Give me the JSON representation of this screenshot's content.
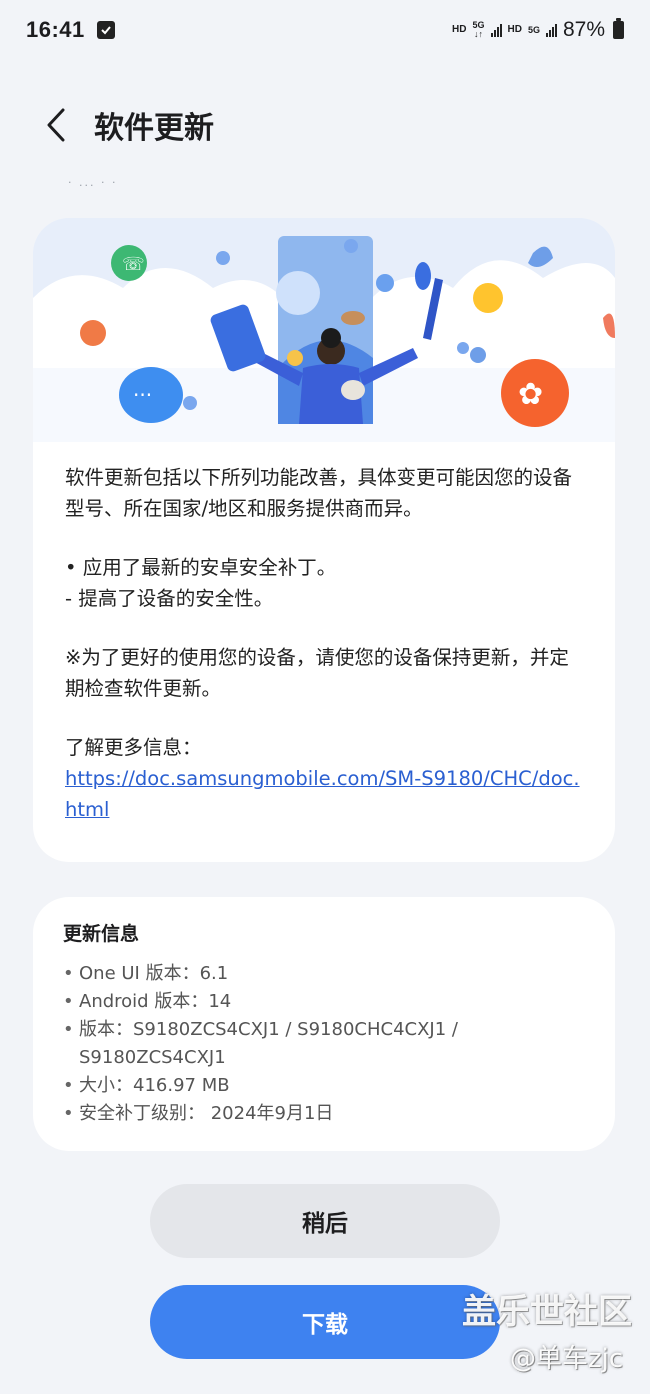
{
  "status_bar": {
    "time": "16:41",
    "hd1": "HD",
    "net1": "5G",
    "hd2": "HD",
    "net2": "5G",
    "battery_percent": "87%"
  },
  "header": {
    "title": "软件更新"
  },
  "faded_text": "· ... · ·",
  "notes": {
    "intro": "软件更新包括以下所列功能改善，具体变更可能因您的设备型号、所在国家/地区和服务提供商而异。",
    "bullet1": "• 应用了最新的安卓安全补丁。",
    "bullet1_sub": " - 提高了设备的安全性。",
    "advice": "※为了更好的使用您的设备，请使您的设备保持更新，并定期检查软件更新。",
    "more_info_label": "了解更多信息：",
    "link": "https://doc.samsungmobile.com/SM-S9180/CHC/doc.html"
  },
  "update_info": {
    "title": "更新信息",
    "items": [
      "One UI 版本：6.1",
      "Android 版本：14",
      "版本：S9180ZCS4CXJ1 / S9180CHC4CXJ1 / S9180ZCS4CXJ1",
      "大小：416.97 MB",
      "安全补丁级别： 2024年9月1日"
    ]
  },
  "buttons": {
    "later": "稍后",
    "download": "下载"
  },
  "watermark": {
    "line1": "盖乐世社区",
    "line2": "@单车zjc"
  },
  "colors": {
    "accent": "#3e82f0",
    "background": "#f2f4f8",
    "link": "#2a5fd1"
  }
}
